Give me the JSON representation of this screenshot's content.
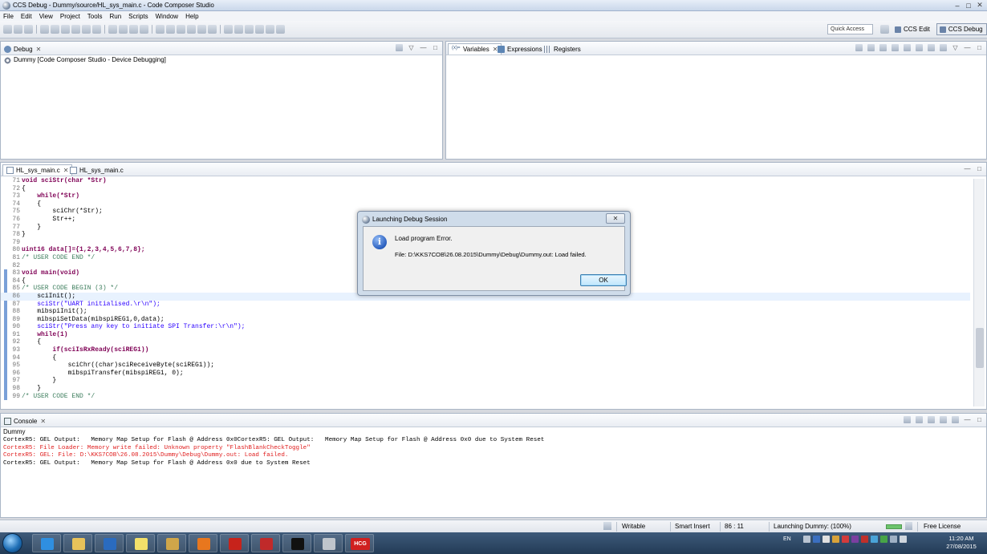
{
  "window": {
    "title": "CCS Debug - Dummy/source/HL_sys_main.c - Code Composer Studio",
    "controls": [
      "–",
      "□",
      "✕"
    ]
  },
  "menu": [
    "File",
    "Edit",
    "View",
    "Project",
    "Tools",
    "Run",
    "Scripts",
    "Window",
    "Help"
  ],
  "toolbar": {
    "quick_access": "Quick Access",
    "perspectives": [
      {
        "label": "CCS Edit",
        "icon": "ccs-edit-icon",
        "active": false
      },
      {
        "label": "CCS Debug",
        "icon": "ccs-debug-icon",
        "active": true
      }
    ]
  },
  "debug_view": {
    "tab": "Debug",
    "tree": [
      "Dummy [Code Composer Studio - Device Debugging]"
    ]
  },
  "variables_view": {
    "tabs": [
      {
        "label": "Variables",
        "icon": "x-equals-icon"
      },
      {
        "label": "Expressions",
        "icon": "expression-icon"
      },
      {
        "label": "Registers",
        "icon": "registers-icon"
      }
    ]
  },
  "editor": {
    "tabs": [
      "HL_sys_main.c",
      "HL_sys_main.c"
    ],
    "lines": [
      {
        "n": "71",
        "t": "void sciStr(char *Str)"
      },
      {
        "n": "72",
        "t": "{"
      },
      {
        "n": "73",
        "t": "    while(*Str)"
      },
      {
        "n": "74",
        "t": "    {"
      },
      {
        "n": "75",
        "t": "        sciChr(*Str);"
      },
      {
        "n": "76",
        "t": "        Str++;"
      },
      {
        "n": "77",
        "t": "    }"
      },
      {
        "n": "78",
        "t": "}"
      },
      {
        "n": "79",
        "t": ""
      },
      {
        "n": "80",
        "t": "uint16 data[]={1,2,3,4,5,6,7,8};"
      },
      {
        "n": "81",
        "t": "/* USER CODE END */"
      },
      {
        "n": "82",
        "t": ""
      },
      {
        "n": "83",
        "t": "void main(void)"
      },
      {
        "n": "84",
        "t": "{"
      },
      {
        "n": "85",
        "t": "/* USER CODE BEGIN (3) */"
      },
      {
        "n": "86",
        "t": "    sciInit();"
      },
      {
        "n": "87",
        "t": "    sciStr(\"UART initialised.\\r\\n\");"
      },
      {
        "n": "88",
        "t": "    mibspiInit();"
      },
      {
        "n": "89",
        "t": "    mibspiSetData(mibspiREG1,0,data);"
      },
      {
        "n": "90",
        "t": "    sciStr(\"Press any key to initiate SPI Transfer:\\r\\n\");"
      },
      {
        "n": "91",
        "t": "    while(1)"
      },
      {
        "n": "92",
        "t": "    {"
      },
      {
        "n": "93",
        "t": "        if(sciIsRxReady(sciREG1))"
      },
      {
        "n": "94",
        "t": "        {"
      },
      {
        "n": "95",
        "t": "            sciChr((char)sciReceiveByte(sciREG1));"
      },
      {
        "n": "96",
        "t": "            mibspiTransfer(mibspiREG1, 0);"
      },
      {
        "n": "97",
        "t": "        }"
      },
      {
        "n": "98",
        "t": "    }"
      },
      {
        "n": "99",
        "t": "/* USER CODE END */"
      }
    ]
  },
  "console": {
    "tab": "Console",
    "name": "Dummy",
    "lines": [
      {
        "text": "CortexR5: GEL Output:   Memory Map Setup for Flash @ Address 0x0CortexR5: GEL Output:   Memory Map Setup for Flash @ Address 0x0 due to System Reset",
        "color": "#000000"
      },
      {
        "text": "CortexR5: File Loader: Memory write failed: Unknown property \"FlashBlankCheckToggle\"",
        "color": "#e01e1e"
      },
      {
        "text": "CortexR5: GEL: File: D:\\KKS7COB\\26.08.2015\\Dummy\\Debug\\Dummy.out: Load failed.",
        "color": "#e01e1e"
      },
      {
        "text": "CortexR5: GEL Output:   Memory Map Setup for Flash @ Address 0x0 due to System Reset",
        "color": "#000000"
      }
    ]
  },
  "statusbar": {
    "writable": "Writable",
    "insert_mode": "Smart Insert",
    "position": "86 : 11",
    "job": "Launching Dummy: (100%)",
    "license": "Free License",
    "progress_percent": 100
  },
  "dialog": {
    "title": "Launching Debug Session",
    "close": "✕",
    "icon": "info-icon",
    "message": "Load program Error.",
    "detail": "File: D:\\KKS7COB\\26.08.2015\\Dummy\\Debug\\Dummy.out: Load failed.",
    "ok": "OK"
  },
  "taskbar": {
    "apps": [
      {
        "name": "internet-explorer",
        "color": "#2f8fe0"
      },
      {
        "name": "file-explorer",
        "color": "#e8c25a"
      },
      {
        "name": "outlook",
        "color": "#2a6bbf"
      },
      {
        "name": "sticky-notes",
        "color": "#f3e06a"
      },
      {
        "name": "virtualbox",
        "color": "#cfa64a"
      },
      {
        "name": "firefox",
        "color": "#e8771e"
      },
      {
        "name": "adobe-reader",
        "color": "#c7231b"
      },
      {
        "name": "pdf-tool",
        "color": "#c02a2a"
      },
      {
        "name": "command-prompt",
        "color": "#111111"
      },
      {
        "name": "3d-box-app",
        "color": "#bfc5cc"
      },
      {
        "name": "hcg",
        "color": "#d02020"
      }
    ],
    "hcg_label": "HCG",
    "lang": "EN",
    "time": "11:20 AM",
    "date": "27/08/2015"
  },
  "colors": {
    "accent": "#2a5fbf",
    "error_text": "#e01e1e",
    "keyword": "#7f0055",
    "string": "#2a00ff",
    "comment": "#3f7f5f"
  }
}
